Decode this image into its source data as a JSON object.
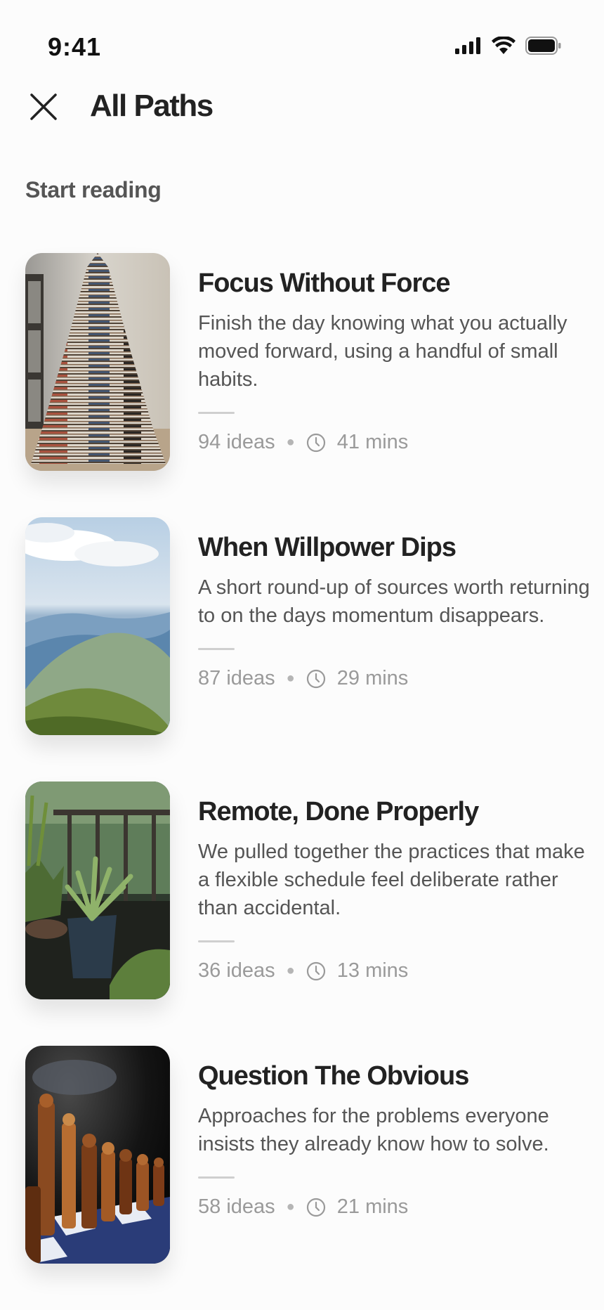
{
  "status_bar": {
    "time": "9:41"
  },
  "header": {
    "title": "All Paths"
  },
  "section": {
    "label": "Start reading"
  },
  "paths": [
    {
      "title": "Focus Without Force",
      "description": "Finish the day knowing what you actually moved forward, using a handful of small habits.",
      "ideas": "94 ideas",
      "duration": "41 mins"
    },
    {
      "title": "When Willpower Dips",
      "description": "A short round-up of sources worth returning to on the days momentum disappears.",
      "ideas": "87 ideas",
      "duration": "29 mins"
    },
    {
      "title": "Remote, Done Properly",
      "description": "We pulled together the practices that make a flexible schedule feel deliberate rather than accidental.",
      "ideas": "36 ideas",
      "duration": "13 mins"
    },
    {
      "title": "Question The Obvious",
      "description": "Approaches for the problems everyone insists they already know how to solve.",
      "ideas": "58 ideas",
      "duration": "21 mins"
    }
  ]
}
